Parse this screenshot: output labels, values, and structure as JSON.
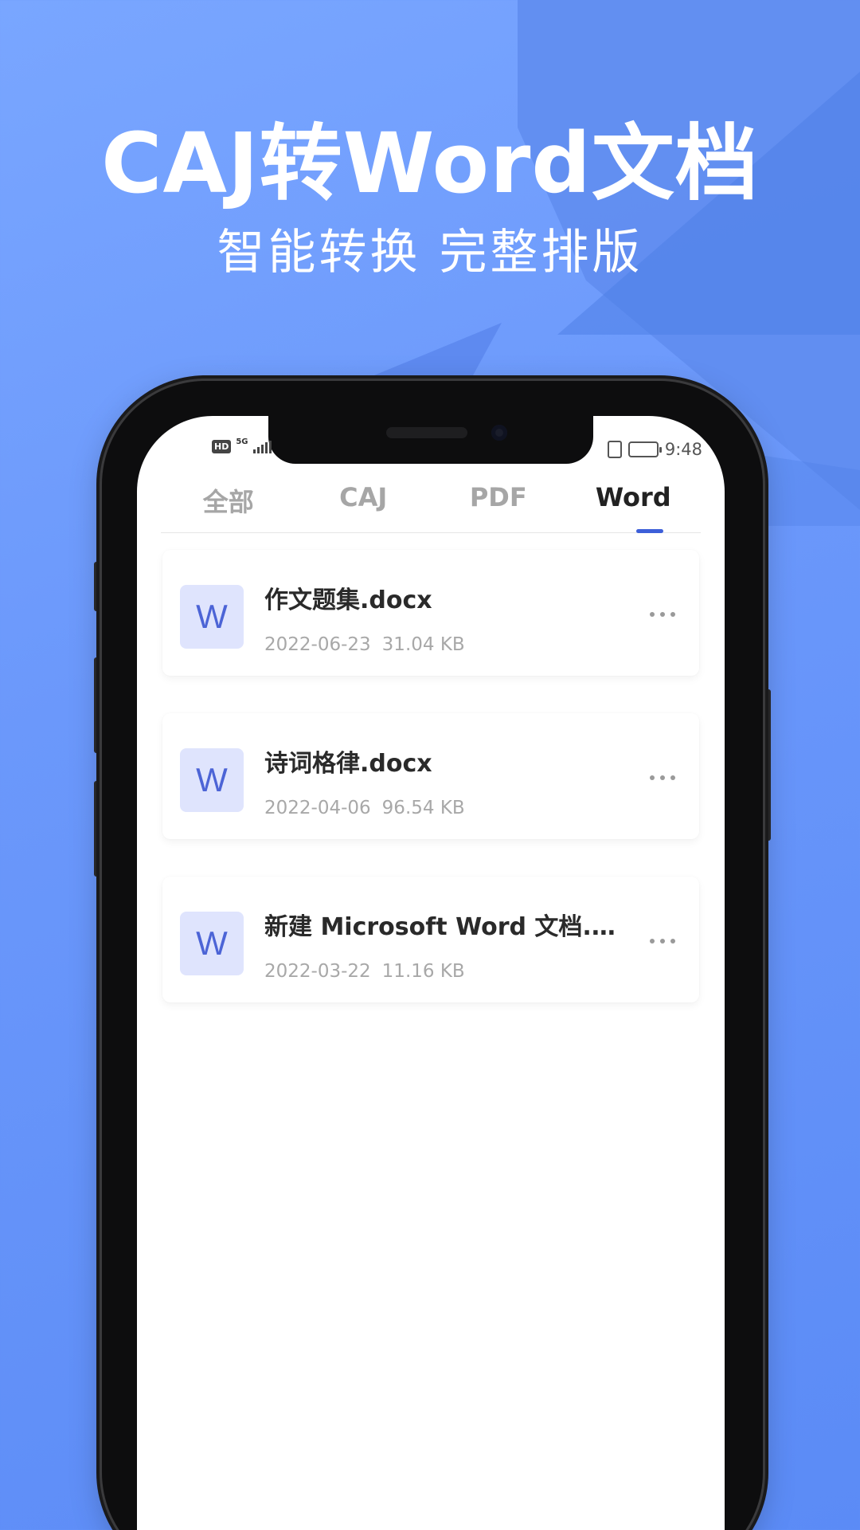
{
  "promo": {
    "title": "CAJ转Word文档",
    "subtitle": "智能转换 完整排版",
    "background_color": "#6b98fb"
  },
  "status_bar": {
    "hd": "HD",
    "network": "5G",
    "time": "9:48"
  },
  "tabs": [
    {
      "label": "全部",
      "active": false
    },
    {
      "label": "CAJ",
      "active": false
    },
    {
      "label": "PDF",
      "active": false
    },
    {
      "label": "Word",
      "active": true
    }
  ],
  "accent_color": "#3d5fd9",
  "files": [
    {
      "icon_letter": "W",
      "name": "作文题集.docx",
      "date": "2022-06-23",
      "size": "31.04 KB"
    },
    {
      "icon_letter": "W",
      "name": "诗词格律.docx",
      "date": "2022-04-06",
      "size": "96.54 KB"
    },
    {
      "icon_letter": "W",
      "name": "新建 Microsoft Word 文档.d...",
      "date": "2022-03-22",
      "size": "11.16 KB"
    }
  ]
}
